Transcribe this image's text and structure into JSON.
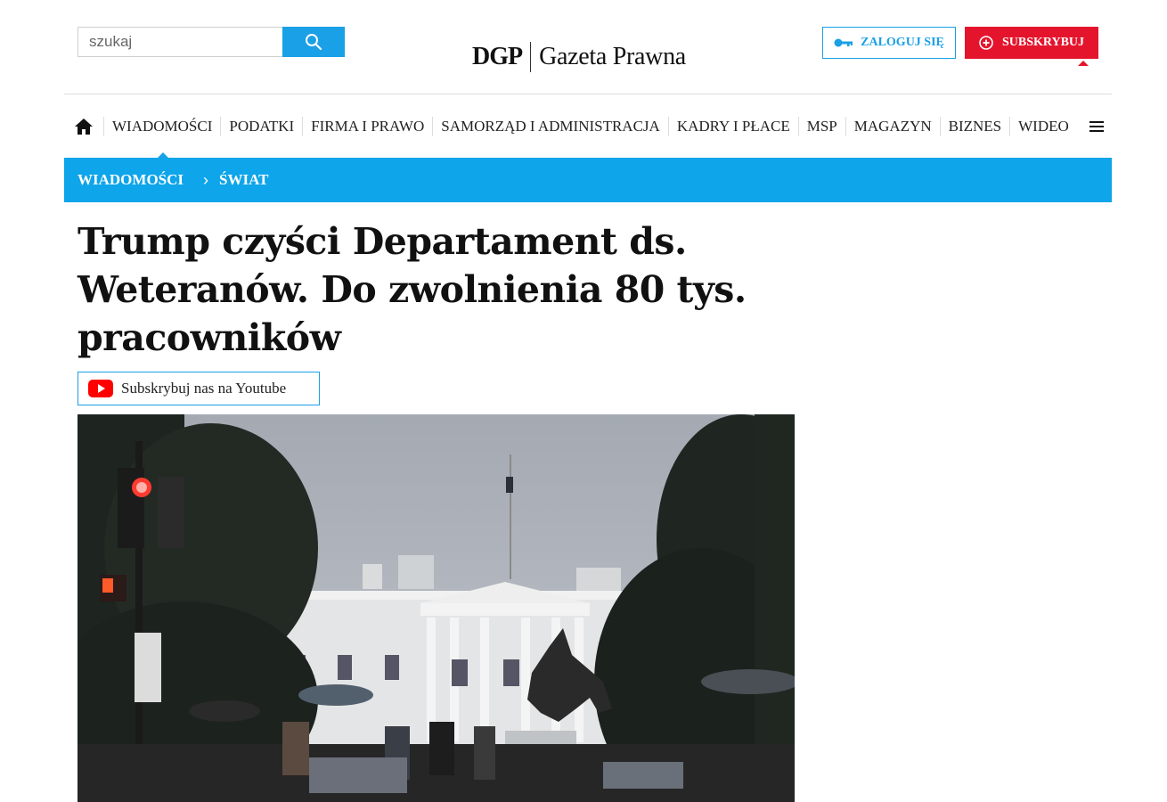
{
  "search": {
    "placeholder": "szukaj"
  },
  "logo": {
    "short": "DGP",
    "name": "Gazeta Prawna"
  },
  "account": {
    "login_label": "ZALOGUJ SIĘ",
    "subscribe_label": "SUBSKRYBUJ"
  },
  "nav": {
    "items": [
      {
        "label": "WIADOMOŚCI"
      },
      {
        "label": "PODATKI"
      },
      {
        "label": "FIRMA I PRAWO"
      },
      {
        "label": "SAMORZĄD I ADMINISTRACJA"
      },
      {
        "label": "KADRY I PŁACE"
      },
      {
        "label": "MSP"
      },
      {
        "label": "MAGAZYN"
      },
      {
        "label": "BIZNES"
      },
      {
        "label": "WIDEO"
      }
    ]
  },
  "breadcrumb": {
    "section": "WIADOMOŚCI",
    "subsection": "ŚWIAT"
  },
  "article": {
    "title": "Trump czyści Departament ds. Weteranów. Do zwolnienia 80 tys. pracowników",
    "youtube_label": "Subskrybuj nas na Youtube"
  },
  "colors": {
    "accent_blue": "#0ea5ea",
    "brand_red": "#e4142c",
    "youtube_red": "#ff0000"
  }
}
